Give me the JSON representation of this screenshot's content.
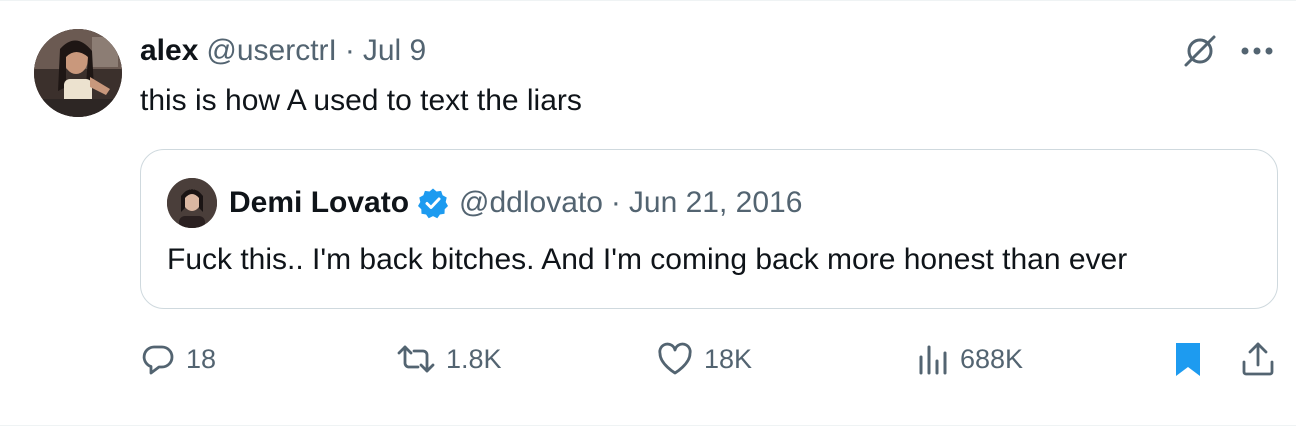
{
  "tweet": {
    "author_name": "alex",
    "author_handle": "@userctrI",
    "separator": "·",
    "date": "Jul 9",
    "text": "this is how A used to text the liars"
  },
  "quote": {
    "author_name": "Demi Lovato",
    "verified": true,
    "author_handle": "@ddlovato",
    "separator": "·",
    "date": "Jun 21, 2016",
    "text": "Fuck this.. I'm back bitches. And I'm coming back more honest than ever"
  },
  "actions": {
    "replies": "18",
    "reposts": "1.8K",
    "likes": "18K",
    "views": "688K",
    "bookmarked": true
  },
  "colors": {
    "text_primary": "#0f1419",
    "text_secondary": "#536471",
    "accent_blue": "#1d9bf0",
    "border": "#cfd9de"
  },
  "icons": [
    "grok-icon",
    "more-icon",
    "reply-icon",
    "repost-icon",
    "like-icon",
    "views-icon",
    "bookmark-icon",
    "share-icon",
    "verified-badge-icon"
  ]
}
